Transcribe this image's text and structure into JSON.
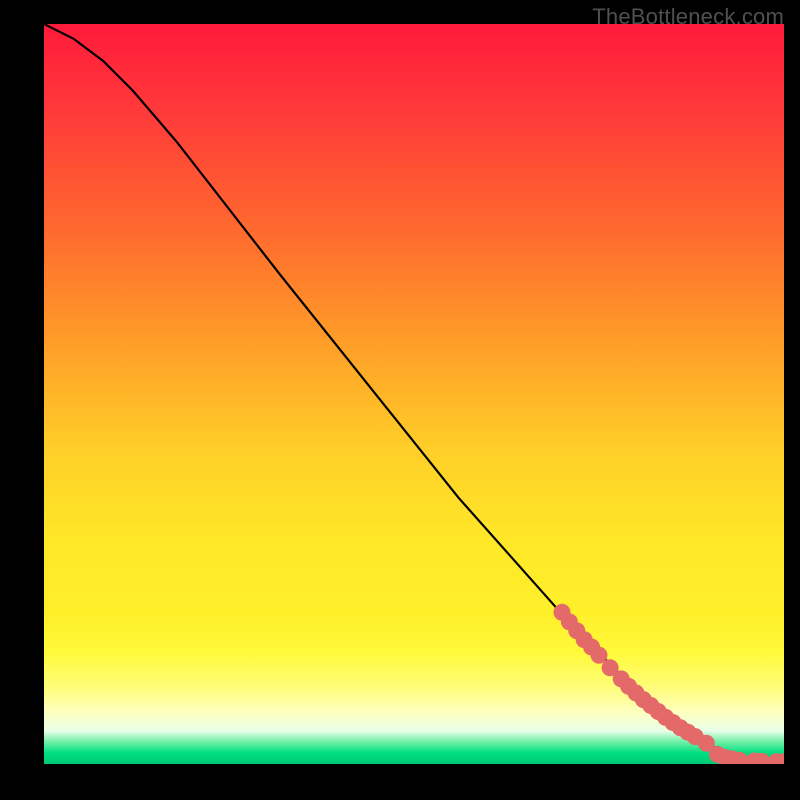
{
  "watermark": "TheBottleneck.com",
  "colors": {
    "curve": "#000000",
    "marker": "#e46a6a",
    "marker_stroke": "#c05050"
  },
  "chart_data": {
    "type": "line",
    "title": "",
    "xlabel": "",
    "ylabel": "",
    "xlim": [
      0,
      100
    ],
    "ylim": [
      0,
      100
    ],
    "grid": false,
    "legend": false,
    "curve_note": "percentage-style curve; x in [0,100] maps left→right, y in [0,100] maps bottom→top; sampled from visible black line",
    "series": [
      {
        "name": "bottleneck-curve",
        "x": [
          0,
          4,
          8,
          12,
          18,
          25,
          32,
          40,
          48,
          56,
          64,
          72,
          78,
          84,
          88,
          91,
          93,
          95,
          97,
          99,
          100
        ],
        "y": [
          100,
          98,
          95,
          91,
          84,
          75,
          66,
          56,
          46,
          36,
          27,
          18,
          12,
          7,
          4,
          2,
          1,
          0.6,
          0.4,
          0.3,
          0.3
        ]
      }
    ],
    "markers_note": "salmon circular markers along the lower-right segment of the curve; coordinates are approximate readings",
    "markers": [
      {
        "x": 70,
        "y": 20.5
      },
      {
        "x": 71,
        "y": 19.2
      },
      {
        "x": 72,
        "y": 18.0
      },
      {
        "x": 73,
        "y": 16.8
      },
      {
        "x": 74,
        "y": 15.8
      },
      {
        "x": 75,
        "y": 14.7
      },
      {
        "x": 76.5,
        "y": 13.0
      },
      {
        "x": 78,
        "y": 11.5
      },
      {
        "x": 79,
        "y": 10.5
      },
      {
        "x": 80,
        "y": 9.6
      },
      {
        "x": 81,
        "y": 8.7
      },
      {
        "x": 82,
        "y": 7.9
      },
      {
        "x": 83,
        "y": 7.1
      },
      {
        "x": 84,
        "y": 6.3
      },
      {
        "x": 85,
        "y": 5.6
      },
      {
        "x": 86,
        "y": 4.9
      },
      {
        "x": 87,
        "y": 4.3
      },
      {
        "x": 88,
        "y": 3.7
      },
      {
        "x": 89.5,
        "y": 2.8
      },
      {
        "x": 91,
        "y": 1.3
      },
      {
        "x": 92,
        "y": 0.9
      },
      {
        "x": 93,
        "y": 0.7
      },
      {
        "x": 94,
        "y": 0.5
      },
      {
        "x": 96,
        "y": 0.4
      },
      {
        "x": 97,
        "y": 0.35
      },
      {
        "x": 99,
        "y": 0.3
      },
      {
        "x": 100,
        "y": 0.3
      }
    ]
  }
}
